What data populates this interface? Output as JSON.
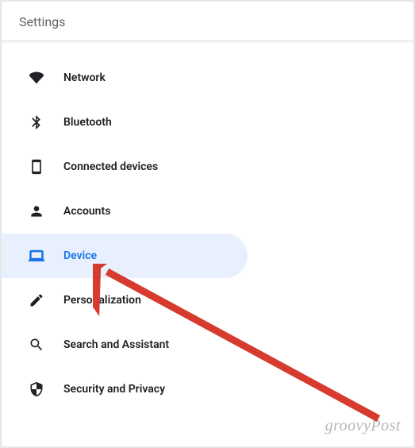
{
  "header": {
    "title": "Settings"
  },
  "nav": {
    "items": [
      {
        "icon": "wifi-icon",
        "label": "Network",
        "selected": false
      },
      {
        "icon": "bluetooth-icon",
        "label": "Bluetooth",
        "selected": false
      },
      {
        "icon": "connected-devices-icon",
        "label": "Connected devices",
        "selected": false
      },
      {
        "icon": "person-icon",
        "label": "Accounts",
        "selected": false
      },
      {
        "icon": "laptop-icon",
        "label": "Device",
        "selected": true
      },
      {
        "icon": "edit-icon",
        "label": "Personalization",
        "selected": false
      },
      {
        "icon": "search-icon",
        "label": "Search and Assistant",
        "selected": false
      },
      {
        "icon": "shield-icon",
        "label": "Security and Privacy",
        "selected": false
      }
    ]
  },
  "watermark": "groovyPost",
  "annotation": {
    "arrow_color": "#d73a2e",
    "points_to": "Device"
  }
}
